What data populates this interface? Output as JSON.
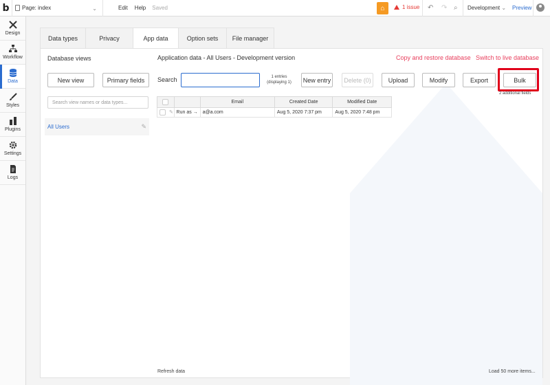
{
  "topbar": {
    "logo": "b",
    "page_label": "Page: index",
    "menu": [
      "Edit",
      "Help"
    ],
    "saved": "Saved",
    "issues": "1 issue",
    "environment": "Development",
    "preview": "Preview"
  },
  "sidebar": {
    "items": [
      {
        "label": "Design",
        "icon": "design-icon"
      },
      {
        "label": "Workflow",
        "icon": "workflow-icon"
      },
      {
        "label": "Data",
        "icon": "database-icon",
        "active": true
      },
      {
        "label": "Styles",
        "icon": "brush-icon"
      },
      {
        "label": "Plugins",
        "icon": "plugin-icon"
      },
      {
        "label": "Settings",
        "icon": "gear-icon"
      },
      {
        "label": "Logs",
        "icon": "document-icon"
      }
    ]
  },
  "tabs": [
    "Data types",
    "Privacy",
    "App data",
    "Option sets",
    "File manager"
  ],
  "active_tab": "App data",
  "database_views": {
    "title": "Database views",
    "new_view": "New view",
    "primary_fields": "Primary fields",
    "search_placeholder": "Search view names or data types...",
    "views": [
      "All Users"
    ]
  },
  "app_data": {
    "title": "Application data - All Users - Development version",
    "copy_restore": "Copy and restore database",
    "switch_live": "Switch to live database",
    "search_label": "Search",
    "entries_line1": "1 entries",
    "entries_line2": "(displaying 1)",
    "buttons": {
      "new_entry": "New entry",
      "delete": "Delete (0)",
      "upload": "Upload",
      "modify": "Modify",
      "export": "Export",
      "bulk": "Bulk"
    },
    "additional_fields": "2 additional fields",
    "table": {
      "headers": [
        "",
        "",
        "Email",
        "Created Date",
        "Modified Date"
      ],
      "rows": [
        {
          "action": "Run as →",
          "email": "a@a.com",
          "created": "Aug 5, 2020 7:37 pm",
          "modified": "Aug 5, 2020 7:48 pm"
        }
      ]
    },
    "refresh": "Refresh data",
    "load_more": "Load 50 more items..."
  },
  "colors": {
    "accent": "#2b6ccf",
    "link_red": "#e8405e",
    "highlight": "#e0001a",
    "gift": "#f59a23"
  }
}
